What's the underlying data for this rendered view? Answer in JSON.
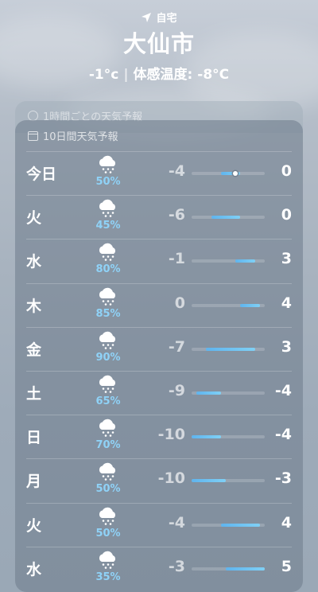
{
  "header": {
    "location_label": "自宅",
    "city": "大仙市",
    "current_temp": "-1°c",
    "separator": "|",
    "feels_like": "体感温度: -8°C"
  },
  "hourly_card": {
    "title": "1時間ごとの天気予報"
  },
  "forecast": {
    "title": "10日間天気予報",
    "range_min": -10,
    "range_max": 5,
    "days": [
      {
        "day": "今日",
        "pct": "50%",
        "low": "-4",
        "high": "0",
        "low_val": -4,
        "high_val": 0,
        "current": -1,
        "icon": "snow-cloud-icon"
      },
      {
        "day": "火",
        "pct": "45%",
        "low": "-6",
        "high": "0",
        "low_val": -6,
        "high_val": 0,
        "icon": "snow-cloud-icon"
      },
      {
        "day": "水",
        "pct": "80%",
        "low": "-1",
        "high": "3",
        "low_val": -1,
        "high_val": 3,
        "icon": "snow-cloud-icon"
      },
      {
        "day": "木",
        "pct": "85%",
        "low": "0",
        "high": "4",
        "low_val": 0,
        "high_val": 4,
        "icon": "snow-cloud-icon"
      },
      {
        "day": "金",
        "pct": "90%",
        "low": "-7",
        "high": "3",
        "low_val": -7,
        "high_val": 3,
        "icon": "snow-cloud-icon"
      },
      {
        "day": "土",
        "pct": "65%",
        "low": "-9",
        "high": "-4",
        "low_val": -9,
        "high_val": -4,
        "icon": "snow-cloud-icon"
      },
      {
        "day": "日",
        "pct": "70%",
        "low": "-10",
        "high": "-4",
        "low_val": -10,
        "high_val": -4,
        "icon": "snow-cloud-icon"
      },
      {
        "day": "月",
        "pct": "50%",
        "low": "-10",
        "high": "-3",
        "low_val": -10,
        "high_val": -3,
        "icon": "snow-cloud-icon"
      },
      {
        "day": "火",
        "pct": "50%",
        "low": "-4",
        "high": "4",
        "low_val": -4,
        "high_val": 4,
        "icon": "snow-cloud-icon"
      },
      {
        "day": "水",
        "pct": "35%",
        "low": "-3",
        "high": "5",
        "low_val": -3,
        "high_val": 5,
        "icon": "snow-cloud-icon"
      }
    ]
  }
}
